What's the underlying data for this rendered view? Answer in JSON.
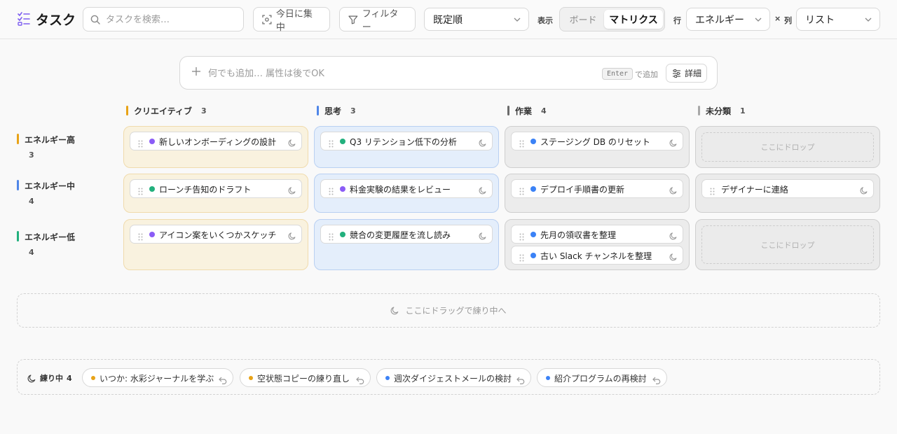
{
  "header": {
    "app_title": "タスク",
    "search_placeholder": "タスクを検索…",
    "focus_today_label": "今日に集中",
    "filter_label": "フィルター",
    "sort_value": "既定順",
    "view_label": "表示",
    "view_options": [
      "ボード",
      "マトリクス"
    ],
    "view_selected": "マトリクス",
    "row_label": "行",
    "row_value": "エネルギー",
    "times": "×",
    "col_label": "列",
    "col_value": "リスト"
  },
  "quick_add": {
    "placeholder": "何でも追加… 属性は後でOK",
    "kbd": "Enter",
    "kbd_suffix": "で追加",
    "detail_label": "詳細"
  },
  "matrix": {
    "columns": [
      {
        "name": "クリエイティブ",
        "count": "3",
        "color": "#e8a317"
      },
      {
        "name": "思考",
        "count": "3",
        "color": "#4f86e8"
      },
      {
        "name": "作業",
        "count": "4",
        "color": "#6b6b6b"
      },
      {
        "name": "未分類",
        "count": "1",
        "color": "#a8a8a8"
      }
    ],
    "rows": [
      {
        "name": "エネルギー高",
        "count": "3",
        "color": "#e8a317"
      },
      {
        "name": "エネルギー中",
        "count": "4",
        "color": "#4f86e8"
      },
      {
        "name": "エネルギー低",
        "count": "4",
        "color": "#22b07d"
      }
    ],
    "drop_label": "ここにドロップ",
    "cells": [
      [
        [
          {
            "title": "新しいオンボーディングの設計",
            "dot": "#8b5cf6"
          }
        ],
        [
          {
            "title": "Q3 リテンション低下の分析",
            "dot": "#22b07d"
          }
        ],
        [
          {
            "title": "ステージング DB のリセット",
            "dot": "#3b82f6"
          }
        ],
        []
      ],
      [
        [
          {
            "title": "ローンチ告知のドラフト",
            "dot": "#22b07d"
          }
        ],
        [
          {
            "title": "料金実験の結果をレビュー",
            "dot": "#8b5cf6"
          }
        ],
        [
          {
            "title": "デプロイ手順書の更新",
            "dot": "#3b82f6"
          }
        ],
        [
          {
            "title": "デザイナーに連絡",
            "dot": null
          }
        ]
      ],
      [
        [
          {
            "title": "アイコン案をいくつかスケッチ",
            "dot": "#8b5cf6"
          }
        ],
        [
          {
            "title": "競合の変更履歴を流し読み",
            "dot": "#22b07d"
          }
        ],
        [
          {
            "title": "先月の領収書を整理",
            "dot": "#3b82f6"
          },
          {
            "title": "古い Slack チャンネルを整理",
            "dot": "#3b82f6"
          }
        ],
        []
      ]
    ]
  },
  "incubate_drop_label": "ここにドラッグで練り中へ",
  "tray": {
    "label": "練り中",
    "count": "4",
    "items": [
      {
        "title": "いつか: 水彩ジャーナルを学ぶ",
        "dot": "#e8a317"
      },
      {
        "title": "空状態コピーの練り直し",
        "dot": "#e8a317"
      },
      {
        "title": "週次ダイジェストメールの検討",
        "dot": "#3b82f6"
      },
      {
        "title": "紹介プログラムの再検討",
        "dot": "#3b82f6"
      }
    ]
  }
}
